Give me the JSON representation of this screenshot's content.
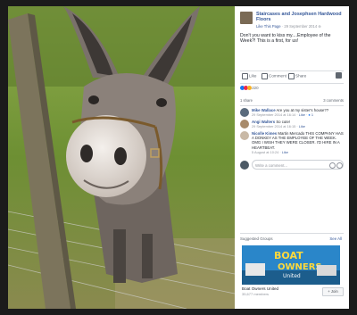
{
  "post": {
    "page_name": "Staircases and Josephsen Hardwood Floors",
    "like_page": "Like This Page",
    "date": "29 September 2014",
    "text": "Don't you want to kiss my....Employee of the Week?! This is a first, for us!"
  },
  "actions": {
    "like": "Like",
    "comment": "Comment",
    "share": "Share"
  },
  "reactions": {
    "count": "220"
  },
  "stats": {
    "shares": "1 share",
    "comments": "3 comments"
  },
  "comments": [
    {
      "name": "Mike Wallace",
      "text": "Are you at my sister's house??",
      "time": "29 September 2014 at 16:14",
      "like": "Like",
      "reply_count": "1"
    },
    {
      "name": "Angi Walters",
      "text": "So cute!",
      "time": "29 September 2014 at 16:15",
      "like": "Like"
    },
    {
      "name": "Nicolle Kimes",
      "text": "Martin Mercado THIS COMPANY HAS A DONKEY AS THE EMPLOYEE OF THE WEEK. OMG I WISH THEY WERE CLOSER. I'D HIRE IN A HEARTBEAT.",
      "time": "5 August at 10:24",
      "like": "Like"
    }
  ],
  "compose": {
    "placeholder": "Write a comment..."
  },
  "suggested": {
    "title": "Suggested Groups",
    "see_all": "See All",
    "banner_line1": "BOAT",
    "banner_line2": "OWNERS",
    "banner_line3": "United",
    "group_name": "Boat Owners United",
    "members": "35,677 members",
    "join": "+ Join"
  },
  "colors": {
    "link": "#365899",
    "meta": "#90949c",
    "like_blue": "#1877f2",
    "love_red": "#f0284a"
  }
}
